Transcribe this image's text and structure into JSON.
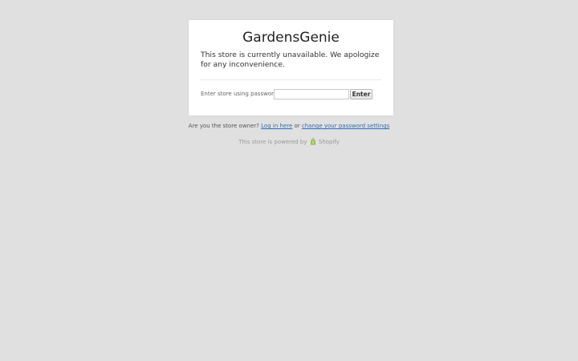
{
  "store": {
    "name": "GardensGenie",
    "message": "This store is currently unavailable. We apologize for any inconvenience."
  },
  "password_form": {
    "label": "Enter store using password:",
    "input_value": "",
    "input_placeholder": "",
    "submit_label": "Enter"
  },
  "owner_prompt": {
    "question": "Are you the store owner?",
    "login_link": "Log in here",
    "or_text": "or",
    "settings_link": "change your password settings"
  },
  "footer": {
    "powered_text": "This store is powered by",
    "brand_name": "Shopify",
    "brand_icon": "shopify-bag-icon",
    "brand_color": "#95bf47"
  },
  "colors": {
    "background": "#e0e0e0",
    "card": "#ffffff",
    "link": "#2d6eb5"
  }
}
